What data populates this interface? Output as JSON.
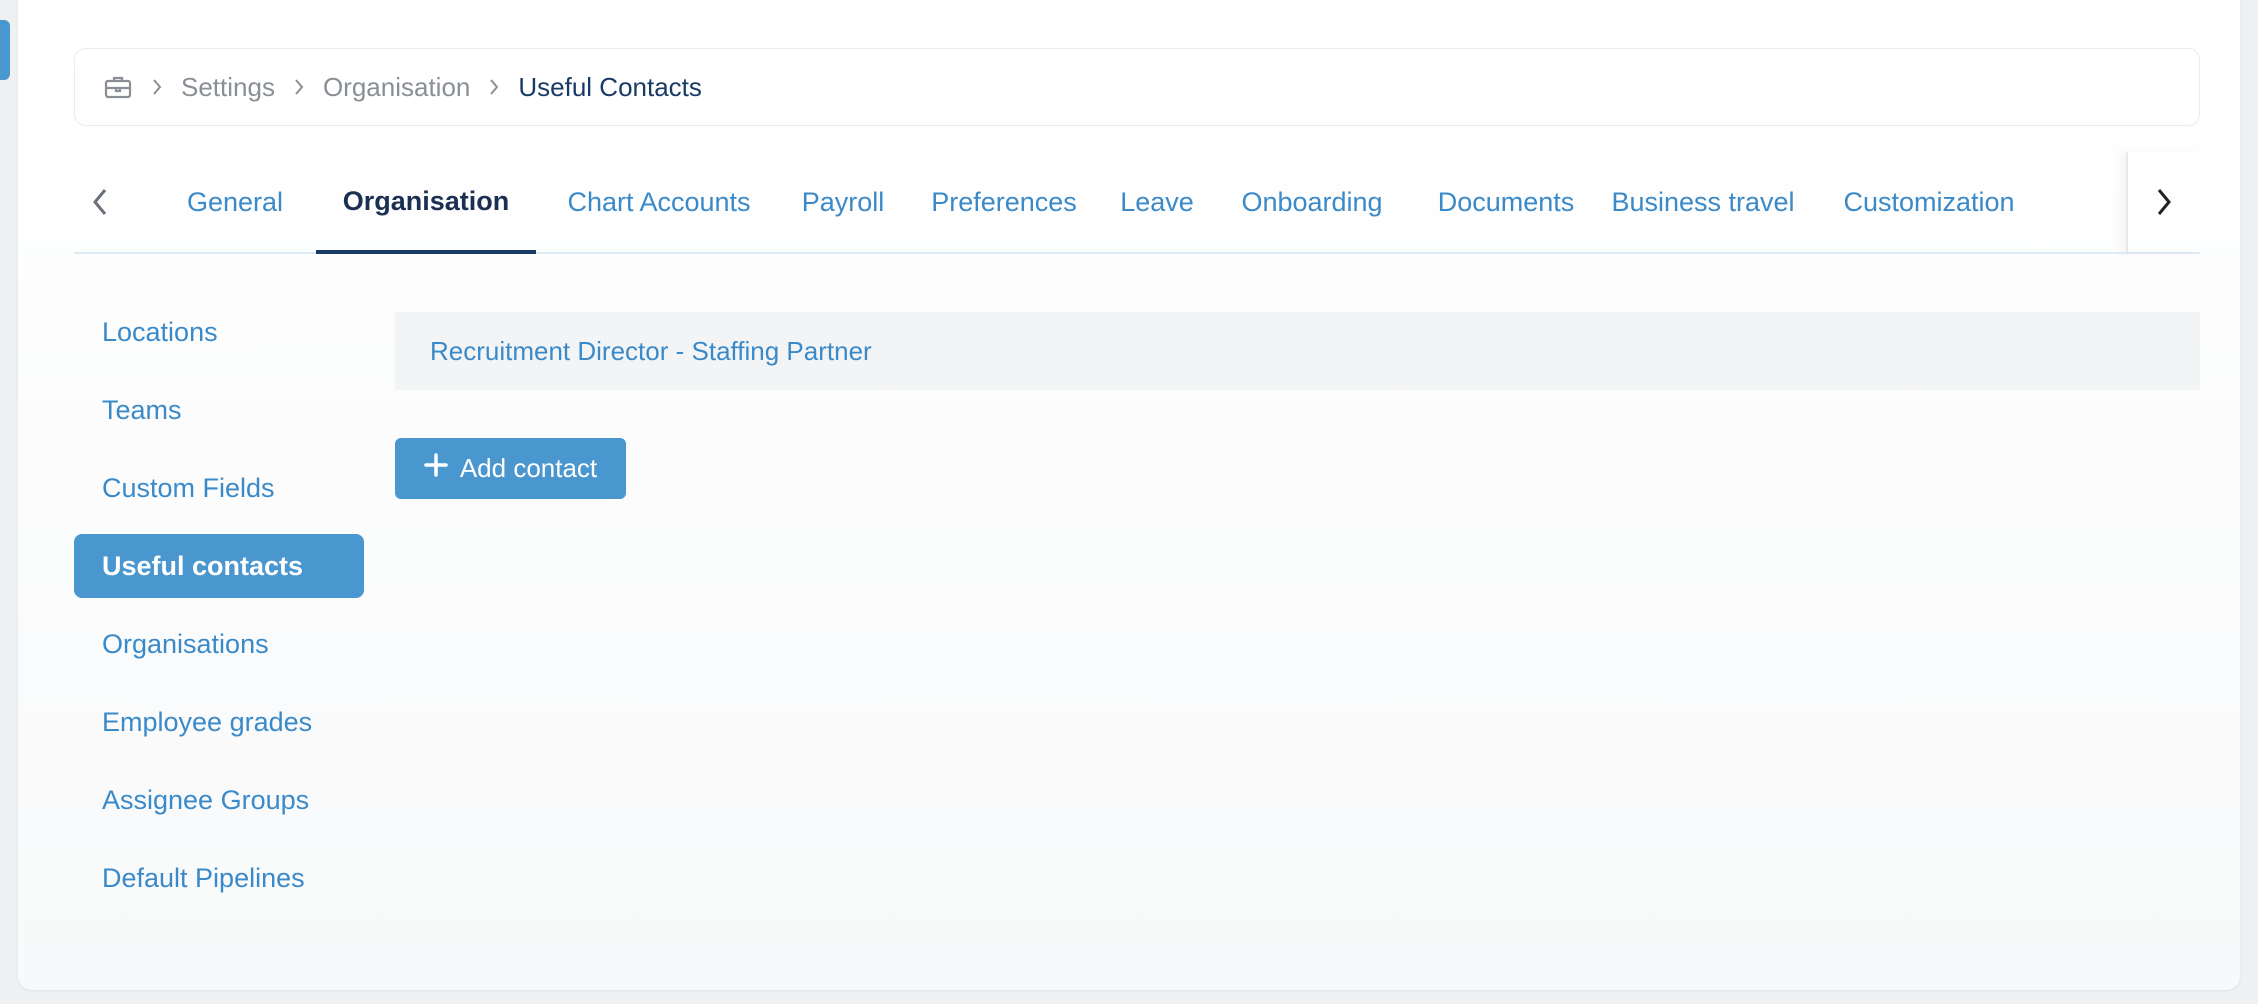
{
  "breadcrumb": {
    "home_icon": "briefcase-icon",
    "items": [
      "Settings",
      "Organisation"
    ],
    "current": "Useful Contacts"
  },
  "tabs": [
    "General",
    "Organisation",
    "Chart Accounts",
    "Payroll",
    "Preferences",
    "Leave",
    "Onboarding",
    "Documents",
    "Business travel",
    "Customization"
  ],
  "active_tab": "Organisation",
  "sidebar": {
    "items": [
      "Locations",
      "Teams",
      "Custom Fields",
      "Useful contacts",
      "Organisations",
      "Employee grades",
      "Assignee Groups",
      "Default Pipelines"
    ],
    "active": "Useful contacts"
  },
  "contacts": [
    "Recruitment Director - Staffing Partner"
  ],
  "add_button": {
    "label": "Add contact",
    "icon": "plus-icon"
  },
  "colors": {
    "accent": "#4a96cf",
    "link": "#3a8ac9",
    "dark": "#1a3a66"
  }
}
